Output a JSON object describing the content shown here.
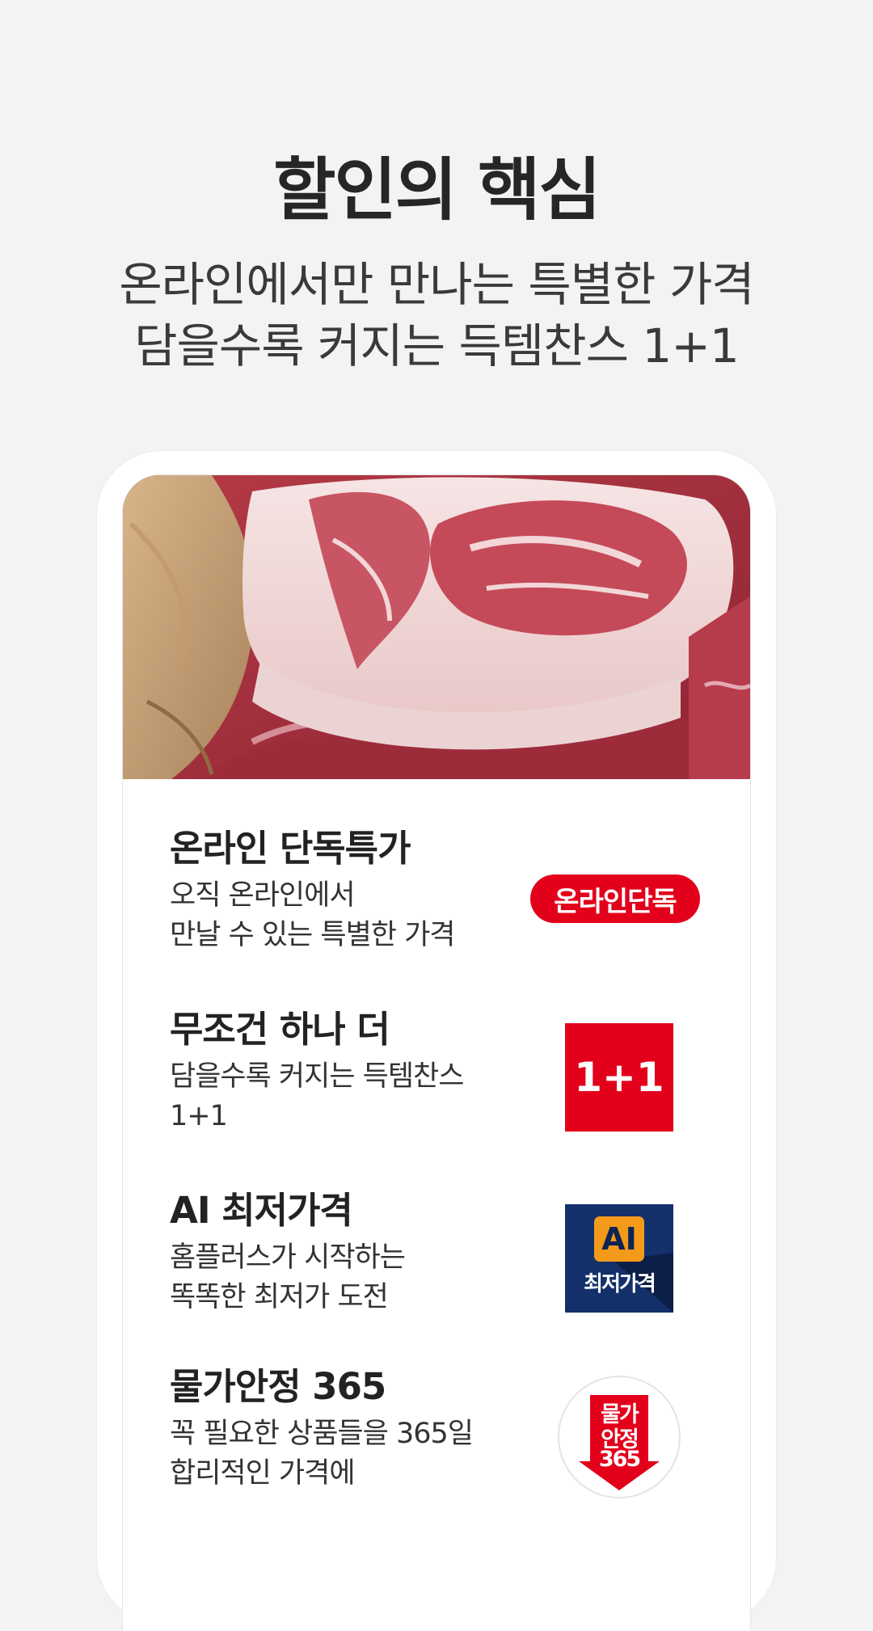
{
  "headline": "할인의 핵심",
  "subline": {
    "line1": "온라인에서만 만나는 특별한 가격",
    "line2": "담을수록 커지는 득템찬스 1+1"
  },
  "features": [
    {
      "title": "온라인 단독특가",
      "desc1": "오직 온라인에서",
      "desc2": "만날 수 있는 특별한 가격",
      "badge": "온라인단독"
    },
    {
      "title": "무조건 하나 더",
      "desc1": "담을수록 커지는 득템찬스",
      "desc2": "1+1",
      "badge": "1+1"
    },
    {
      "title": "AI 최저가격",
      "desc1": "홈플러스가 시작하는",
      "desc2": "똑똑한 최저가 도전",
      "badge_top": "AI",
      "badge_bottom": "최저가격"
    },
    {
      "title": "물가안정 365",
      "desc1": "꼭 필요한 상품들을 365일",
      "desc2": "합리적인 가격에",
      "badge_l1": "물가",
      "badge_l2": "안정",
      "badge_l3": "365"
    }
  ],
  "colors": {
    "background": "#f3f3f3",
    "brand_red": "#e3001b",
    "ai_navy": "#14306b",
    "ai_orange": "#f39a1a"
  },
  "icons": {
    "hero": "meat-photo",
    "badge1": "online-exclusive-pill",
    "badge2": "one-plus-one-square",
    "badge3": "ai-lowest-price-tile",
    "badge4": "price-stable-365-arrow"
  }
}
